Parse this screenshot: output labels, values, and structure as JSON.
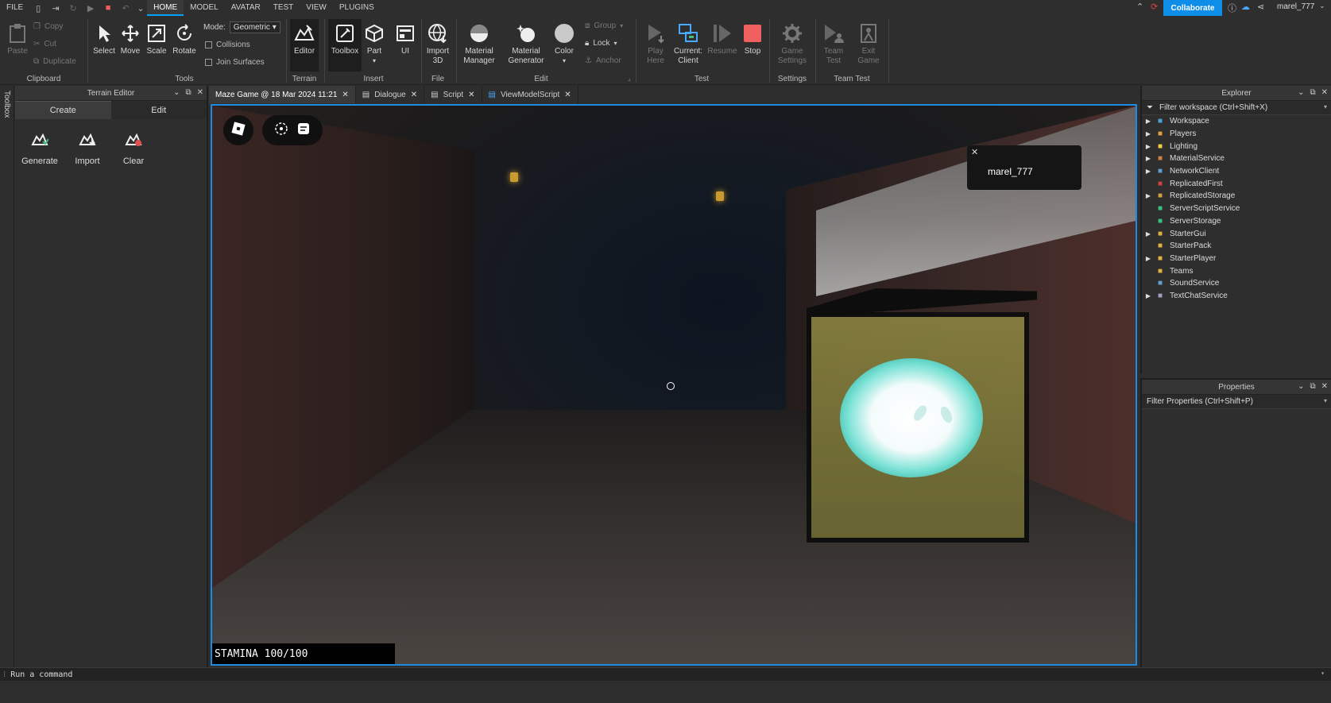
{
  "menubar": {
    "items": [
      "FILE",
      "HOME",
      "MODEL",
      "AVATAR",
      "TEST",
      "VIEW",
      "PLUGINS"
    ],
    "active": "HOME",
    "collaborate": "Collaborate",
    "username": "marel_777"
  },
  "ribbon": {
    "clipboard": {
      "paste": "Paste",
      "copy": "Copy",
      "cut": "Cut",
      "duplicate": "Duplicate",
      "label": "Clipboard"
    },
    "tools": {
      "select": "Select",
      "move": "Move",
      "scale": "Scale",
      "rotate": "Rotate",
      "mode_label": "Mode:",
      "mode_value": "Geometric",
      "collisions": "Collisions",
      "join_surfaces": "Join Surfaces",
      "label": "Tools"
    },
    "terrain": {
      "editor": "Editor",
      "label": "Terrain"
    },
    "insert": {
      "toolbox": "Toolbox",
      "part": "Part",
      "ui": "UI",
      "label": "Insert"
    },
    "file": {
      "import3d_1": "Import",
      "import3d_2": "3D",
      "label": "File"
    },
    "edit": {
      "material_manager_1": "Material",
      "material_manager_2": "Manager",
      "material_generator_1": "Material",
      "material_generator_2": "Generator",
      "color": "Color",
      "group": "Group",
      "lock": "Lock",
      "anchor": "Anchor",
      "label": "Edit"
    },
    "test": {
      "play_here_1": "Play",
      "play_here_2": "Here",
      "current_client_1": "Current:",
      "current_client_2": "Client",
      "resume": "Resume",
      "stop": "Stop",
      "label": "Test"
    },
    "settings": {
      "game_settings_1": "Game",
      "game_settings_2": "Settings",
      "label": "Settings"
    },
    "team_test": {
      "team_test_1": "Team",
      "team_test_2": "Test",
      "exit_game_1": "Exit",
      "exit_game_2": "Game",
      "label": "Team Test"
    }
  },
  "toolbox_tab": "Toolbox",
  "terrain_editor": {
    "title": "Terrain Editor",
    "tabs": [
      "Create",
      "Edit"
    ],
    "tools": [
      "Generate",
      "Import",
      "Clear"
    ]
  },
  "doc_tabs": [
    {
      "label": "Maze Game @ 18 Mar 2024 11:21",
      "active": true
    },
    {
      "label": "Dialogue",
      "active": false
    },
    {
      "label": "Script",
      "active": false
    },
    {
      "label": "ViewModelScript",
      "active": false
    }
  ],
  "viewport": {
    "player_card_name": "marel_777",
    "stamina": "STAMINA 100/100"
  },
  "explorer": {
    "title": "Explorer",
    "filter": "Filter workspace (Ctrl+Shift+X)",
    "items": [
      {
        "label": "Workspace",
        "expandable": true,
        "icon": "globe-icon",
        "color": "#4fa3d9"
      },
      {
        "label": "Players",
        "expandable": true,
        "icon": "players-icon",
        "color": "#e0a040"
      },
      {
        "label": "Lighting",
        "expandable": true,
        "icon": "bulb-icon",
        "color": "#f0d040"
      },
      {
        "label": "MaterialService",
        "expandable": true,
        "icon": "material-icon",
        "color": "#d08040"
      },
      {
        "label": "NetworkClient",
        "expandable": true,
        "icon": "network-icon",
        "color": "#60a0d0"
      },
      {
        "label": "ReplicatedFirst",
        "expandable": false,
        "icon": "replicated-icon",
        "color": "#d04040"
      },
      {
        "label": "ReplicatedStorage",
        "expandable": true,
        "icon": "storage-icon",
        "color": "#d0a040"
      },
      {
        "label": "ServerScriptService",
        "expandable": false,
        "icon": "server-script-icon",
        "color": "#40c080"
      },
      {
        "label": "ServerStorage",
        "expandable": false,
        "icon": "server-storage-icon",
        "color": "#40c080"
      },
      {
        "label": "StarterGui",
        "expandable": true,
        "icon": "folder-icon",
        "color": "#e0b040"
      },
      {
        "label": "StarterPack",
        "expandable": false,
        "icon": "folder-icon",
        "color": "#e0b040"
      },
      {
        "label": "StarterPlayer",
        "expandable": true,
        "icon": "folder-icon",
        "color": "#e0b040"
      },
      {
        "label": "Teams",
        "expandable": false,
        "icon": "folder-icon",
        "color": "#e0b040"
      },
      {
        "label": "SoundService",
        "expandable": false,
        "icon": "sound-icon",
        "color": "#60a0d0"
      },
      {
        "label": "TextChatService",
        "expandable": true,
        "icon": "chat-icon",
        "color": "#a0a0c0"
      }
    ]
  },
  "properties": {
    "title": "Properties",
    "filter": "Filter Properties (Ctrl+Shift+P)"
  },
  "command_bar": {
    "placeholder": "Run a command"
  },
  "colors": {
    "accent": "#1d8ce0",
    "collaborate": "#0e8ee8",
    "stop": "#f06060",
    "orb": "#7fe3d7"
  }
}
